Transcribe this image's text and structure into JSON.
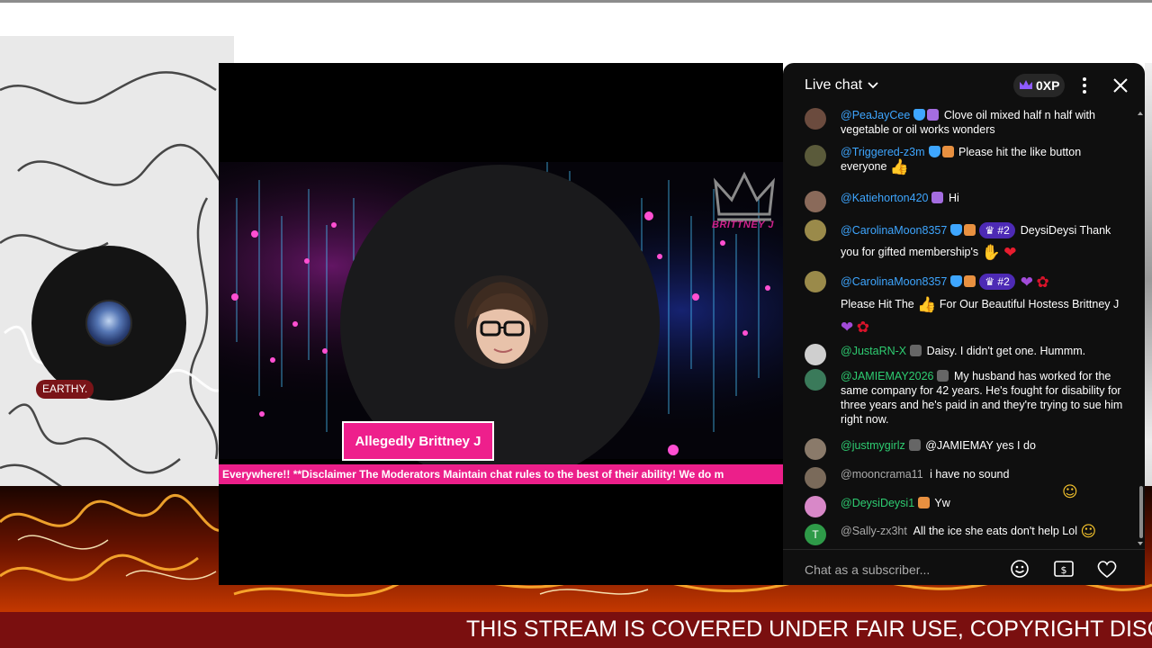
{
  "overlay": {
    "earthy_label": "EARTHY.",
    "banner_text": "THIS STREAM IS COVERED UNDER FAIR USE, COPYRIGHT DISC"
  },
  "video": {
    "name_tag": "Allegedly Brittney J",
    "logo_text": "BRITTNEY J",
    "ticker": "Everywhere!! **Disclaimer The Moderators Maintain chat rules to the best of their ability! We do m",
    "colors": {
      "accent": "#ee1f8c"
    }
  },
  "chat": {
    "title": "Live chat",
    "xp": "0XP",
    "input_placeholder": "Chat as a subscriber...",
    "messages": [
      {
        "author": "@PeaJayCee",
        "text": "Clove oil mixed half n half with vegetable or oil works wonders"
      },
      {
        "author": "@Triggered-z3m",
        "text": "Please hit the like button everyone"
      },
      {
        "author": "@Katiehorton420",
        "text": "Hi"
      },
      {
        "author": "@CarolinaMoon8357",
        "gift": "#2",
        "text": "DeysiDeysi Thank you for gifted membership's"
      },
      {
        "author": "@CarolinaMoon8357",
        "gift": "#2",
        "text_a": "Please Hit The",
        "text_b": "For Our Beautiful Hostess Brittney J"
      },
      {
        "author": "@JustaRN-X",
        "text": "Daisy. I didn't get one. Hummm."
      },
      {
        "author": "@JAMIEMAY2026",
        "text": "My husband has worked for the same company for 42 years. He's fought for disability for three years and he's paid in and they're trying to sue him right now."
      },
      {
        "author": "@justmygirlz",
        "text": "@JAMIEMAY yes I do"
      },
      {
        "author": "@mooncrama11",
        "text": "i have no sound"
      },
      {
        "author": "@DeysiDeysi1",
        "text": "Yw"
      },
      {
        "author": "@Sally-zx3ht",
        "avatar_letter": "T",
        "text": "All the ice she eats don't help Lol"
      }
    ]
  }
}
